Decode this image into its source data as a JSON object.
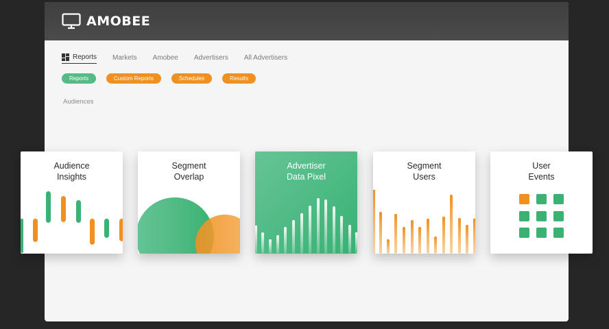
{
  "app": {
    "title": "AMOBEE",
    "logo_icon": "monitor-icon"
  },
  "nav": {
    "items": [
      {
        "label": "Reports",
        "active": true,
        "icon": "grid-icon"
      },
      {
        "label": "Markets"
      },
      {
        "label": "Amobee"
      },
      {
        "label": "Advertisers"
      },
      {
        "label": "All Advertisers"
      }
    ]
  },
  "pills": [
    {
      "label": "Reports",
      "color": "#55bb85"
    },
    {
      "label": "Custom Reports",
      "color": "#f0901e"
    },
    {
      "label": "Schedules",
      "color": "#f0901e"
    },
    {
      "label": "Results",
      "color": "#f0901e"
    }
  ],
  "section": {
    "label": "Audiences"
  },
  "cards": [
    {
      "title": "Audience\nInsights",
      "graphic": "candlestick-bars"
    },
    {
      "title": "Segment\nOverlap",
      "graphic": "overlap-circles"
    },
    {
      "title": "Advertiser\nData Pixel",
      "graphic": "bar-histogram",
      "highlighted": true
    },
    {
      "title": "Segment\nUsers",
      "graphic": "vertical-bars"
    },
    {
      "title": "User\nEvents",
      "graphic": "square-grid"
    }
  ],
  "colors": {
    "green": "#3bb273",
    "orange": "#f0901e",
    "titlebar": "#454545"
  }
}
